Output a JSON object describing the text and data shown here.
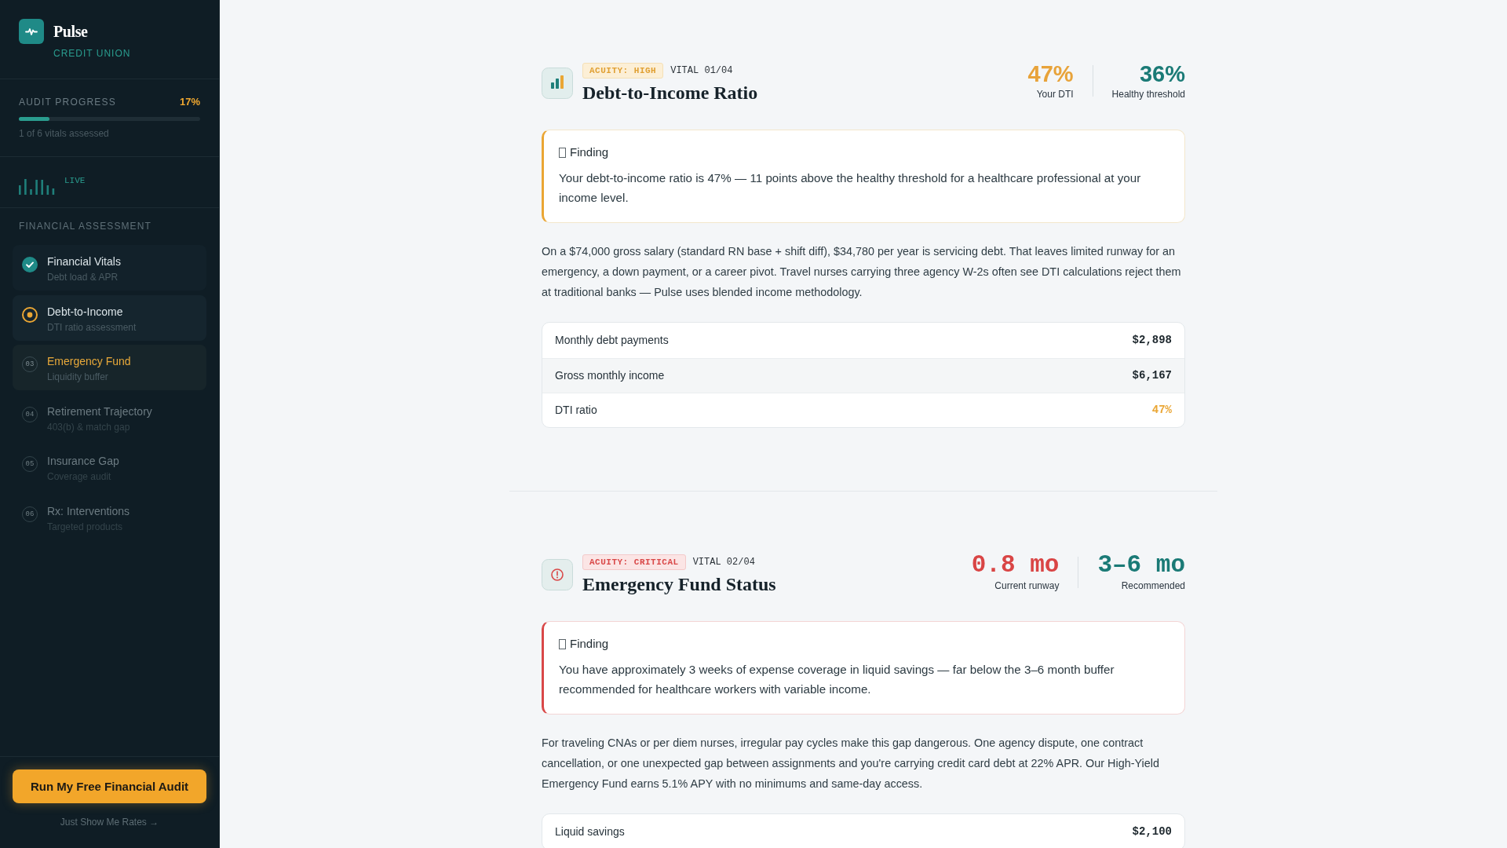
{
  "sidebar": {
    "brand": {
      "name": "Pulse",
      "tagline": "CREDIT UNION"
    },
    "progress": {
      "label": "AUDIT PROGRESS",
      "value": "17%",
      "level": 0.17,
      "caption": "1 of 6 vitals assessed"
    },
    "live": {
      "label": "LIVE"
    },
    "nav_heading": "FINANCIAL ASSESSMENT",
    "nav_items": [
      {
        "title": "Financial Vitals",
        "subtitle": "Debt load & APR",
        "kind": "done",
        "selected": false
      },
      {
        "title": "Debt-to-Income",
        "subtitle": "DTI ratio assessment",
        "kind": "current",
        "selected": false
      },
      {
        "title": "Emergency Fund",
        "subtitle": "Liquidity buffer",
        "kind": "pending",
        "number": "03",
        "selected": true
      },
      {
        "title": "Retirement Trajectory",
        "subtitle": "403(b) & match gap",
        "kind": "pending",
        "number": "04",
        "selected": false
      },
      {
        "title": "Insurance Gap",
        "subtitle": "Coverage audit",
        "kind": "pending",
        "number": "05",
        "selected": false
      },
      {
        "title": "Rx: Interventions",
        "subtitle": "Targeted products",
        "kind": "pending",
        "number": "06",
        "selected": false
      }
    ],
    "cta": {
      "label": "Run My Free Financial Audit"
    },
    "secondary_link": "Just Show Me Rates →"
  },
  "sections": [
    {
      "kind": "ratio",
      "critical": false,
      "badge": "ACUITY: HIGH",
      "vital": "VITAL 01/04",
      "title": "Debt-to-Income Ratio",
      "stats": [
        {
          "value": "47%",
          "label": "Your DTI",
          "color": "#e8a33a"
        },
        {
          "value": "36%",
          "label": "Healthy threshold",
          "color": "#1a7a76"
        }
      ],
      "finding": {
        "heading": "Finding",
        "text": "Your debt-to-income ratio is 47% — 11 points above the healthy threshold for a healthcare professional at your income level."
      },
      "body": "On a $74,000 gross salary (standard RN base + shift diff), $34,780 per year is servicing debt. That leaves limited runway for an emergency, a down payment, or a career pivot. Travel nurses carrying three agency W-2s often see DTI calculations reject them at traditional banks — Pulse uses blended income methodology.",
      "rows": [
        {
          "label": "Monthly debt payments",
          "value": "$2,898",
          "highlighted": false
        },
        {
          "label": "Gross monthly income",
          "value": "$6,167",
          "highlighted": false
        },
        {
          "label": "DTI ratio",
          "value": "47%",
          "highlighted": true
        }
      ]
    },
    {
      "kind": "duration",
      "critical": true,
      "badge": "ACUITY: CRITICAL",
      "vital": "VITAL 02/04",
      "title": "Emergency Fund Status",
      "stats": [
        {
          "value": "0.8 mo",
          "label": "Current runway",
          "color": "#d94545"
        },
        {
          "value": "3–6 mo",
          "label": "Recommended",
          "color": "#1a7a76"
        }
      ],
      "finding": {
        "heading": "Finding",
        "text": "You have approximately 3 weeks of expense coverage in liquid savings — far below the 3–6 month buffer recommended for healthcare workers with variable income."
      },
      "body": "For traveling CNAs or per diem nurses, irregular pay cycles make this gap dangerous. One agency dispute, one contract cancellation, or one unexpected gap between assignments and you're carrying credit card debt at 22% APR. Our High-Yield Emergency Fund earns 5.1% APY with no minimums and same-day access.",
      "rows": [
        {
          "label": "Liquid savings",
          "value": "$2,100",
          "highlighted": false
        }
      ]
    }
  ]
}
